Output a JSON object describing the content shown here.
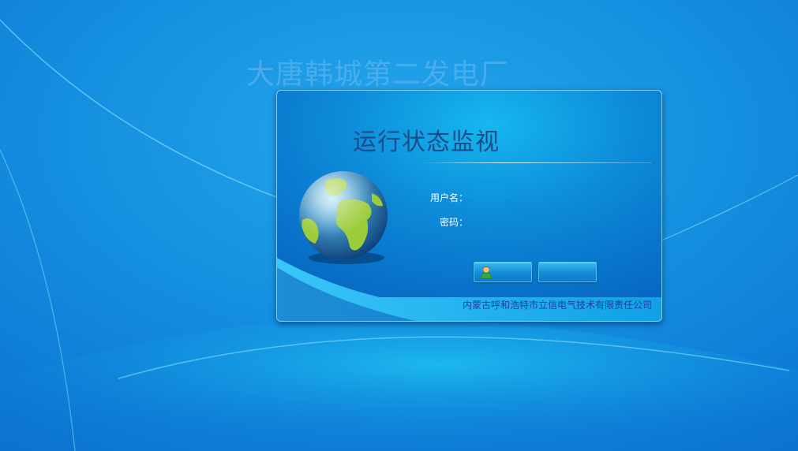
{
  "window": {
    "company_name": "大唐韩城第二发电厂"
  },
  "login_panel": {
    "title": "运行状态监视",
    "username_label": "用户名：",
    "password_label": "密码：",
    "username_value": "",
    "password_value": "",
    "login_icon": "user-icon",
    "decorative_icon": "globe-icon"
  },
  "footer": {
    "vendor": "内蒙古呼和浩特市立信电气技术有限责任公司"
  },
  "colors": {
    "background": "#1590e0",
    "panel": "#0d8ad8",
    "title": "#1a4d88",
    "footer_text": "#1f3ca0"
  }
}
